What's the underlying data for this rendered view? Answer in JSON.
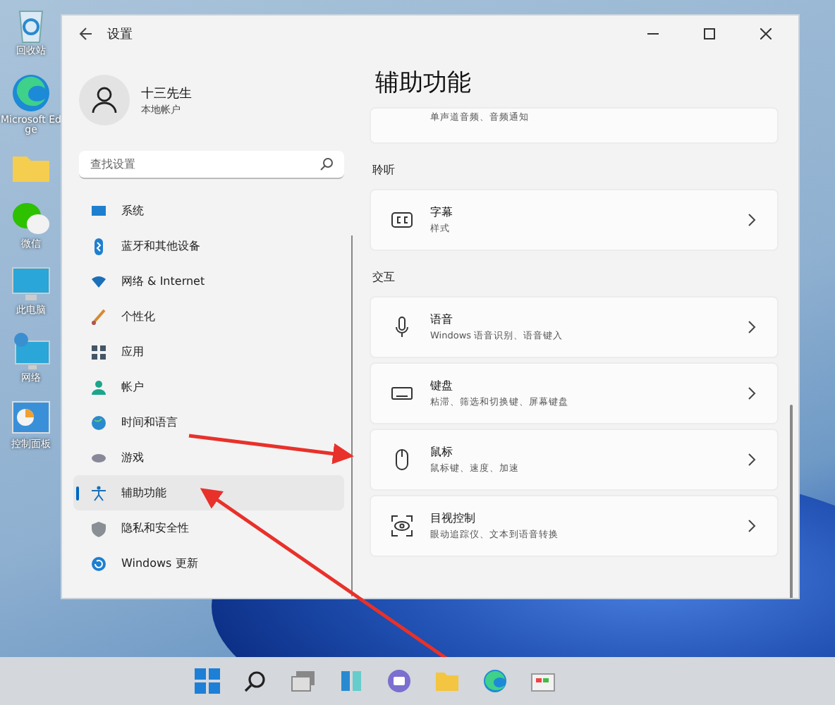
{
  "desktop_icons": [
    {
      "kind": "recycle",
      "label": "回收站"
    },
    {
      "kind": "edge",
      "label": "Microsoft Edge"
    },
    {
      "kind": "folder"
    },
    {
      "kind": "wechat",
      "label": "微信"
    },
    {
      "kind": "pc",
      "label": "此电脑"
    },
    {
      "kind": "network",
      "label": "网络"
    },
    {
      "kind": "control",
      "label": "控制面板"
    }
  ],
  "window": {
    "title": "设置"
  },
  "user": {
    "name": "十三先生",
    "account": "本地帐户"
  },
  "search": {
    "placeholder": "查找设置"
  },
  "sidebar": {
    "items": [
      {
        "kind": "system",
        "label": "系统",
        "selected": false
      },
      {
        "kind": "bluetooth",
        "label": "蓝牙和其他设备",
        "selected": false
      },
      {
        "kind": "network",
        "label": "网络 & Internet",
        "selected": false
      },
      {
        "kind": "personalize",
        "label": "个性化",
        "selected": false
      },
      {
        "kind": "apps",
        "label": "应用",
        "selected": false
      },
      {
        "kind": "account",
        "label": "帐户",
        "selected": false
      },
      {
        "kind": "time",
        "label": "时间和语言",
        "selected": false
      },
      {
        "kind": "gaming",
        "label": "游戏",
        "selected": false
      },
      {
        "kind": "accessibility",
        "label": "辅助功能",
        "selected": true
      },
      {
        "kind": "privacy",
        "label": "隐私和安全性",
        "selected": false
      },
      {
        "kind": "update",
        "label": "Windows 更新",
        "selected": false
      }
    ]
  },
  "page": {
    "title": "辅助功能",
    "partial_card": {
      "subtitle": "单声道音频、音频通知"
    },
    "sections": [
      {
        "heading": "聆听",
        "cards": [
          {
            "kind": "captions",
            "title": "字幕",
            "subtitle": "样式"
          }
        ]
      },
      {
        "heading": "交互",
        "cards": [
          {
            "kind": "speech",
            "title": "语音",
            "subtitle": "Windows 语音识别、语音键入"
          },
          {
            "kind": "keyboard",
            "title": "键盘",
            "subtitle": "粘滞、筛选和切换键、屏幕键盘"
          },
          {
            "kind": "mouse",
            "title": "鼠标",
            "subtitle": "鼠标键、速度、加速"
          },
          {
            "kind": "eye",
            "title": "目视控制",
            "subtitle": "眼动追踪仪、文本到语音转换"
          }
        ]
      }
    ]
  },
  "taskbar": {
    "items": [
      {
        "kind": "start"
      },
      {
        "kind": "search"
      },
      {
        "kind": "taskview"
      },
      {
        "kind": "widgets"
      },
      {
        "kind": "chat"
      },
      {
        "kind": "folder"
      },
      {
        "kind": "edge"
      },
      {
        "kind": "store"
      }
    ]
  }
}
